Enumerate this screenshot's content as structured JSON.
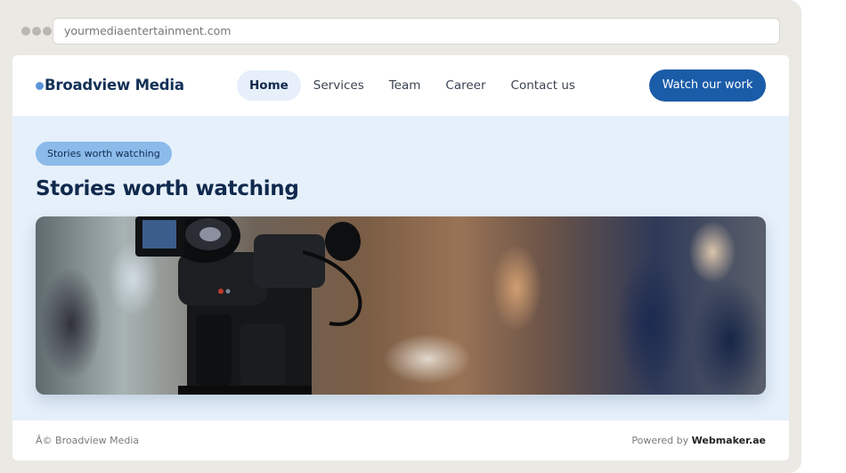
{
  "browser": {
    "url": "yourmediaentertainment.com"
  },
  "brand": {
    "name": "Broadview Media",
    "dot_color": "#5b95d9"
  },
  "nav": {
    "items": [
      {
        "label": "Home",
        "active": true
      },
      {
        "label": "Services",
        "active": false
      },
      {
        "label": "Team",
        "active": false
      },
      {
        "label": "Career",
        "active": false
      },
      {
        "label": "Contact us",
        "active": false
      }
    ],
    "cta_label": "Watch our work"
  },
  "hero": {
    "tag": "Stories worth watching",
    "title": "Stories worth watching",
    "image_icon": "video-camera-photo"
  },
  "footer": {
    "copyright": "Â© Broadview Media",
    "powered_prefix": "Powered by",
    "powered_brand": "Webmaker.ae"
  },
  "colors": {
    "accent": "#1b5ca8",
    "hero_bg": "#e6f0fb",
    "pill_bg": "#8cbbea",
    "title": "#10294d"
  }
}
